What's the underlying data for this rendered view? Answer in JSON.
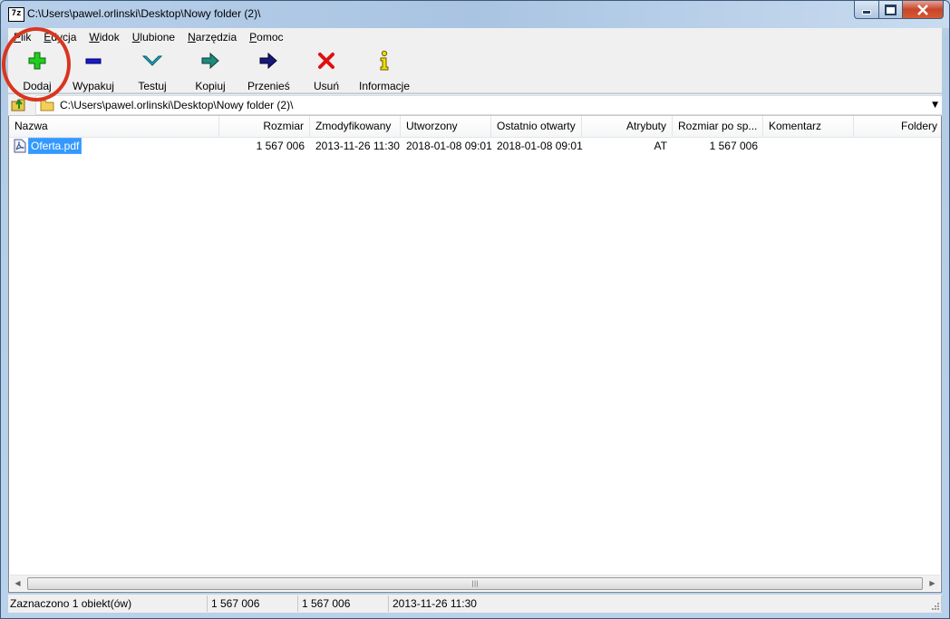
{
  "window": {
    "title": "C:\\Users\\pawel.orlinski\\Desktop\\Nowy folder (2)\\",
    "app_icon_label": "7z",
    "accent_close": "#c7452b"
  },
  "menu": [
    "Plik",
    "Edycja",
    "Widok",
    "Ulubione",
    "Narzędzia",
    "Pomoc"
  ],
  "toolbar": [
    {
      "label": "Dodaj",
      "icon": "add-icon"
    },
    {
      "label": "Wypakuj",
      "icon": "extract-icon"
    },
    {
      "label": "Testuj",
      "icon": "test-icon"
    },
    {
      "label": "Kopiuj",
      "icon": "copy-icon"
    },
    {
      "label": "Przenieś",
      "icon": "move-icon"
    },
    {
      "label": "Usuń",
      "icon": "delete-icon"
    },
    {
      "label": "Informacje",
      "icon": "info-icon"
    }
  ],
  "address": {
    "path": "C:\\Users\\pawel.orlinski\\Desktop\\Nowy folder (2)\\"
  },
  "columns": [
    "Nazwa",
    "Rozmiar",
    "Zmodyfikowany",
    "Utworzony",
    "Ostatnio otwarty",
    "Atrybuty",
    "Rozmiar po sp...",
    "Komentarz",
    "Foldery"
  ],
  "files": [
    {
      "name": "Oferta.pdf",
      "size": "1 567 006",
      "modified": "2013-11-26 11:30",
      "created": "2018-01-08 09:01",
      "accessed": "2018-01-08 09:01",
      "attributes": "AT",
      "packed_size": "1 567 006",
      "comment": "",
      "folders": ""
    }
  ],
  "status": {
    "selected": "Zaznaczono 1 obiekt(ów)",
    "size": "1 567 006",
    "packed": "1 567 006",
    "date": "2013-11-26 11:30"
  },
  "highlight_color": "#d9351e"
}
